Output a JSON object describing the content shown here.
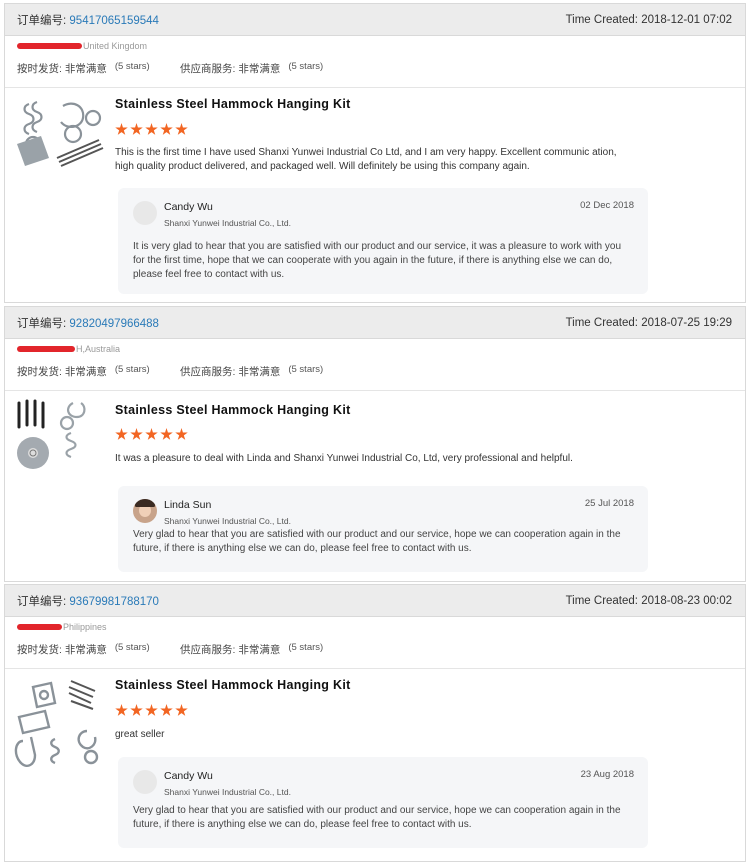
{
  "orders": [
    {
      "order_label": "订单编号:",
      "order_number": "95417065159544",
      "time_created": "Time Created: 2018-12-01 07:02",
      "buyer_country": "United Kingdom",
      "ship_label": "按时发货: 非常满意",
      "ship_stars": "(5 stars)",
      "service_label": "供应商服务: 非常满意",
      "service_stars": "(5 stars)",
      "product_title": "Stainless Steel Hammock Hanging Kit",
      "rating": 5,
      "review": "This is the first time I have used Shanxi Yunwei Industrial Co Ltd, and I am very happy. Excellent communic ation, high quality product delivered, and packaged well. Will definitely be using this company again.",
      "reply": {
        "name": "Candy Wu",
        "company": "Shanxi Yunwei Industrial Co., Ltd.",
        "date": "02 Dec 2018",
        "text": "It is very glad to hear that you are satisfied with our product and our service, it was a pleasure to work with you for the first time, hope that we can cooperate with you again in the future, if there is anything else we can do, please feel free to contact with us."
      }
    },
    {
      "order_label": "订单编号:",
      "order_number": "92820497966488",
      "time_created": "Time Created: 2018-07-25 19:29",
      "buyer_country": "H,Australia",
      "ship_label": "按时发货: 非常满意",
      "ship_stars": "(5 stars)",
      "service_label": "供应商服务: 非常满意",
      "service_stars": "(5 stars)",
      "product_title": "Stainless Steel Hammock Hanging Kit",
      "rating": 5,
      "review": "It was a pleasure to deal with Linda and Shanxi Yunwei Industrial Co, Ltd, very professional and helpful.",
      "reply": {
        "name": "Linda Sun",
        "company": "Shanxi Yunwei Industrial Co., Ltd.",
        "date": "25 Jul 2018",
        "text": "Very glad to hear that you are satisfied with our product and our service, hope we can cooperation again in the future,  if there is anything else we can do, please feel free to contact with us."
      }
    },
    {
      "order_label": "订单编号:",
      "order_number": "93679981788170",
      "time_created": "Time Created: 2018-08-23 00:02",
      "buyer_country": "Philippines",
      "ship_label": "按时发货: 非常满意",
      "ship_stars": "(5 stars)",
      "service_label": "供应商服务: 非常满意",
      "service_stars": "(5 stars)",
      "product_title": "Stainless Steel Hammock Hanging Kit",
      "rating": 5,
      "review": "great seller",
      "reply": {
        "name": "Candy Wu",
        "company": "Shanxi Yunwei Industrial Co., Ltd.",
        "date": "23 Aug 2018",
        "text": "Very glad to hear that you are satisfied with our product and our service, hope we can cooperation again in the future, if there is anything else we can do, please feel free to contact with us."
      }
    }
  ],
  "colors": {
    "accent_link": "#2a7ab8",
    "star": "#f26522",
    "redaction": "#e2252b",
    "header_bg": "#ececec"
  }
}
